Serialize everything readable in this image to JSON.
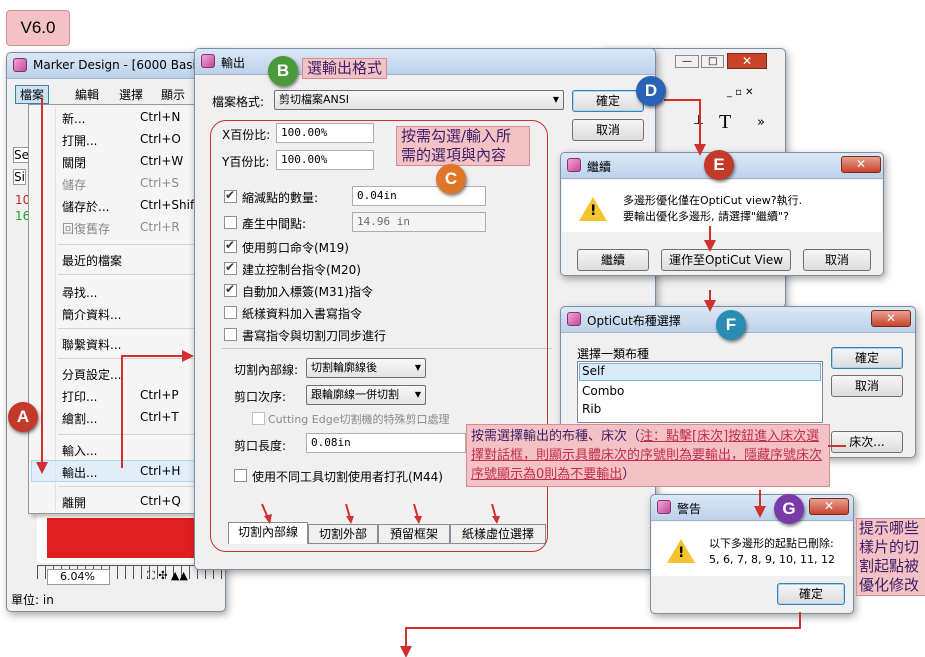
{
  "version_tag": "V6.0",
  "main_window": {
    "title": "Marker Design - [6000 Basic",
    "menubar": [
      "檔案",
      "編輯",
      "選擇",
      "顯示"
    ],
    "zoom": "6.04%",
    "status": "單位: in",
    "side_letters": [
      "Se",
      "Si",
      "10",
      "16"
    ]
  },
  "file_menu": {
    "items": [
      {
        "label": "新...",
        "key": "Ctrl+N"
      },
      {
        "label": "打開...",
        "key": "Ctrl+O"
      },
      {
        "label": "關閉",
        "key": "Ctrl+W"
      },
      {
        "label": "儲存",
        "key": "Ctrl+S"
      },
      {
        "label": "儲存於...",
        "key": "Ctrl+Shift"
      },
      {
        "label": "回復舊存",
        "key": "Ctrl+R"
      },
      {
        "label": "最近的檔案",
        "key": ""
      },
      {
        "label": "尋找...",
        "key": ""
      },
      {
        "label": "簡介資料...",
        "key": ""
      },
      {
        "label": "聯繫資料...",
        "key": ""
      },
      {
        "label": "分頁設定...",
        "key": ""
      },
      {
        "label": "打印...",
        "key": "Ctrl+P"
      },
      {
        "label": "繪割...",
        "key": "Ctrl+T"
      },
      {
        "label": "輸入...",
        "key": ""
      },
      {
        "label": "輸出...",
        "key": "Ctrl+H"
      },
      {
        "label": "離開",
        "key": "Ctrl+Q"
      }
    ]
  },
  "output_dialog": {
    "title": "輸出",
    "format_label": "檔案格式:",
    "format_value": "剪切檔案ANSI",
    "ok": "確定",
    "cancel": "取消",
    "x_label": "X百份比:",
    "x_value": "100.00%",
    "y_label": "Y百份比:",
    "y_value": "100.00%",
    "options": [
      {
        "label": "縮減點的數量:",
        "checked": true,
        "value": "0.04in"
      },
      {
        "label": "產生中間點:",
        "checked": false,
        "value": "14.96 in"
      },
      {
        "label": "使用剪口命令(M19)",
        "checked": true
      },
      {
        "label": "建立控制台指令(M20)",
        "checked": true
      },
      {
        "label": "自動加入標簽(M31)指令",
        "checked": true
      },
      {
        "label": "紙樣資料加入書寫指令",
        "checked": false
      },
      {
        "label": "書寫指令與切割刀同步進行",
        "checked": false
      }
    ],
    "inner_label": "切割內部線:",
    "inner_value": "切割輪廓線後",
    "notch_label": "剪口次序:",
    "notch_value": "跟輪廓線一併切割",
    "cutting_edge": "Cutting Edge切割機的特殊剪口處理",
    "notch_len_label": "剪口長度:",
    "notch_len_value": "0.08in",
    "tool_punch": "使用不同工具切割使用者打孔(M44)",
    "tabs": [
      "切割內部線",
      "切割外部",
      "預留框架",
      "紙樣虛位選擇"
    ]
  },
  "continue_dialog": {
    "title": "繼續",
    "message": "多邊形優化僅在OptiCut view?執行.\n要輸出優化多邊形, 請選擇\"繼續\"?",
    "buttons": [
      "繼續",
      "運作至OptiCut View",
      "取消"
    ]
  },
  "layout_dialog": {
    "title": "OptiCut布種選擇",
    "label": "選擇一類布種",
    "items": [
      "Self",
      "Combo",
      "Rib"
    ],
    "ok": "確定",
    "cancel": "取消",
    "bed": "床次..."
  },
  "warning_dialog": {
    "title": "警告",
    "message1": "以下多邊形的起點已刪除:",
    "message2": "5, 6, 7, 8, 9, 10, 11, 12",
    "ok": "確定"
  },
  "toolbar_right": {
    "T": "T",
    "more": "»"
  },
  "callouts": {
    "B": "選輸出格式",
    "C": "按需勾選/輸入所\n需的選項與內容",
    "F_before": "按需選擇輸出的布種、床次（",
    "F_note": "注：點擊[床次]按鈕進入床次選擇對話框，則顯示具體床次的序號則為要輸出，隱藏序號床次序號顯示為0則為不要輸出",
    "F_after": "）",
    "G": "提示哪些\n樣片的切\n割起點被\n優化修改"
  },
  "badges": {
    "A": "A",
    "B": "B",
    "C": "C",
    "D": "D",
    "E": "E",
    "F": "F",
    "G": "G"
  },
  "colors": {
    "badge_red": "#c43a2a",
    "badge_green": "#4a9a3a",
    "badge_orange": "#e0762a",
    "badge_blue": "#2a62b8",
    "badge_purple": "#7a3aa8",
    "badge_teal": "#2a8cb0"
  }
}
